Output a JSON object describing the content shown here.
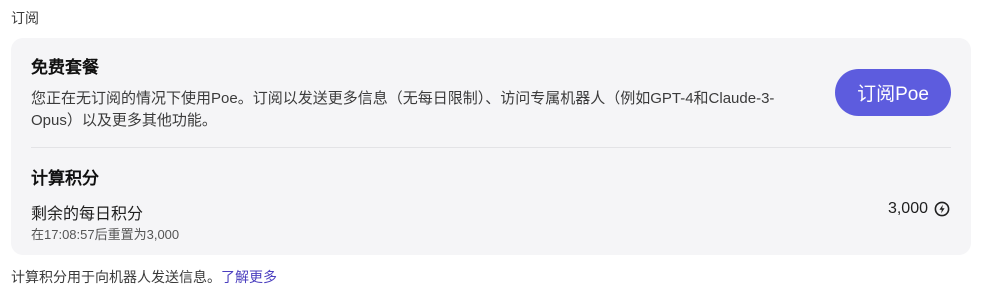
{
  "section_label": "订阅",
  "plan": {
    "title": "免费套餐",
    "description": "您正在无订阅的情况下使用Poe。订阅以发送更多信息（无每日限制）、访问专属机器人（例如GPT-4和Claude-3-Opus）以及更多其他功能。",
    "subscribe_label": "订阅Poe"
  },
  "points": {
    "title": "计算积分",
    "daily_label": "剩余的每日积分",
    "reset_text": "在17:08:57后重置为3,000",
    "value": "3,000",
    "icon": "compute-points-icon"
  },
  "footer": {
    "text": "计算积分用于向机器人发送信息。",
    "link_label": "了解更多"
  },
  "colors": {
    "accent": "#5d5cde",
    "card_bg": "#f5f5f7",
    "link": "#4b3fbf"
  }
}
